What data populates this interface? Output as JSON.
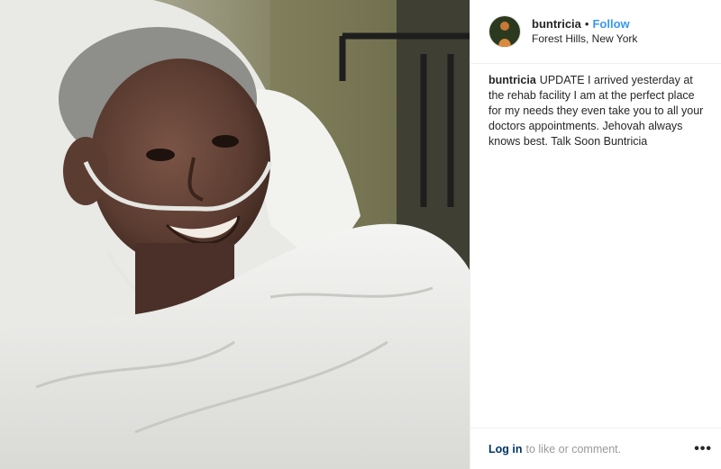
{
  "header": {
    "username": "buntricia",
    "separator": "•",
    "follow_label": "Follow",
    "location": "Forest Hills, New York"
  },
  "caption": {
    "username": "buntricia",
    "text": "UPDATE I arrived yesterday at the rehab facility I am at the perfect place for my needs they even take you to all your doctors appointments. Jehovah always knows best. Talk Soon Buntricia"
  },
  "footer": {
    "login_label": "Log in",
    "rest_text": "to like or comment.",
    "more_icon": "more-options-icon",
    "more_glyph": "•••"
  },
  "colors": {
    "follow": "#3897f0",
    "login": "#003569",
    "muted": "#999999",
    "text": "#262626"
  }
}
